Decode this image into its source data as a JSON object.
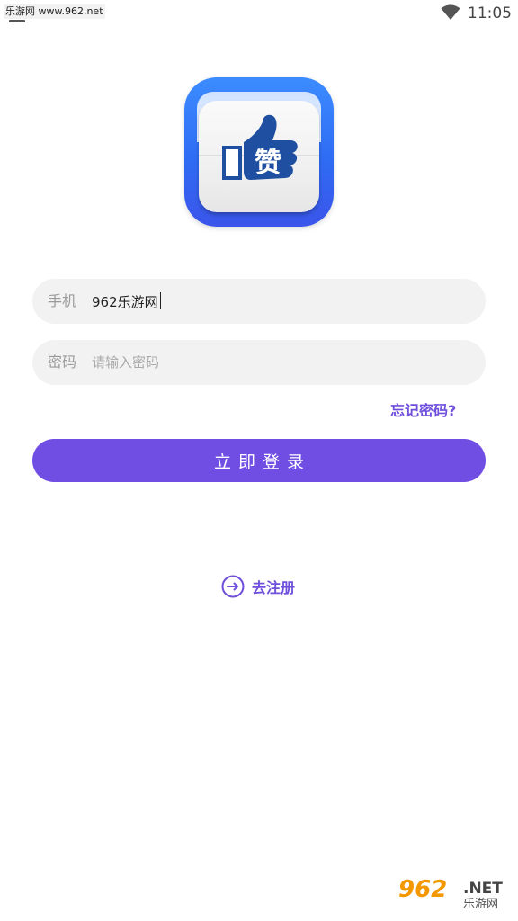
{
  "status_bar": {
    "watermark": "乐游网 www.962.net",
    "time": "11:05",
    "wifi_icon": "wifi-icon"
  },
  "logo": {
    "icon": "thumbs-up-icon",
    "glyph": "赞",
    "colors": {
      "outer": "#2f6cf4",
      "card": "#f4f4f4",
      "thumb": "#1e4fa0"
    }
  },
  "form": {
    "phone": {
      "label": "手机",
      "value": "962乐游网",
      "placeholder": ""
    },
    "password": {
      "label": "密码",
      "value": "",
      "placeholder": "请输入密码"
    },
    "forgot_label": "忘记密码?",
    "login_label": "立即登录"
  },
  "register": {
    "icon": "arrow-right-circle-icon",
    "label": "去注册"
  },
  "watermark_bottom": {
    "number": "962",
    "net": ".NET",
    "cn": "乐游网"
  },
  "theme": {
    "accent": "#704ee4",
    "link": "#6f4fdc",
    "input_bg": "#f2f2f3"
  }
}
